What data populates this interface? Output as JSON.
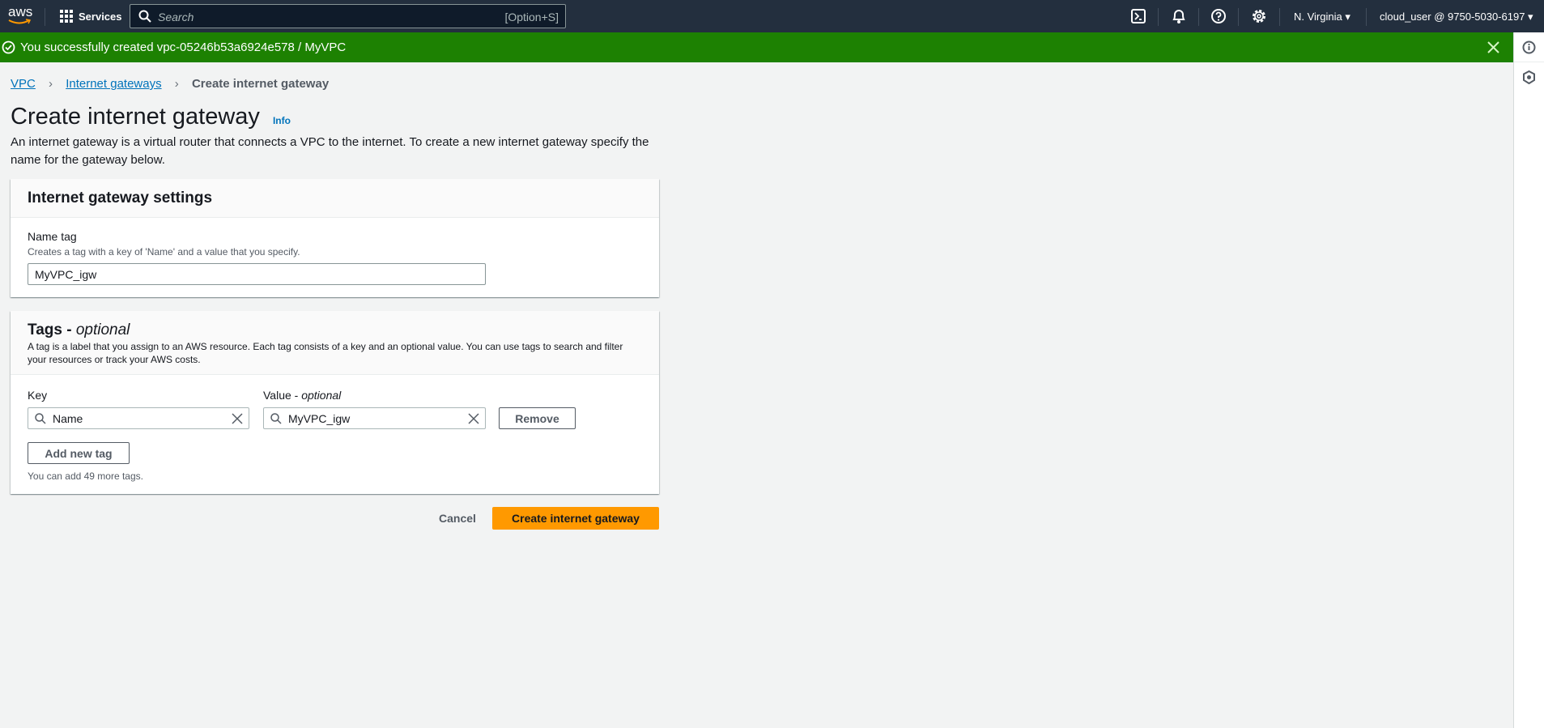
{
  "nav": {
    "logo_text": "aws",
    "services_label": "Services",
    "search_placeholder": "Search",
    "search_shortcut": "[Option+S]",
    "region": "N. Virginia",
    "account": "cloud_user @ 9750-5030-6197",
    "icons": [
      "grid-icon",
      "search-icon",
      "terminal-icon",
      "bell-icon",
      "help-icon",
      "gear-icon"
    ]
  },
  "banner": {
    "message": "You successfully created vpc-05246b53a6924e578 / MyVPC",
    "color": "#1d8102"
  },
  "breadcrumb": [
    "VPC",
    "Internet gateways",
    "Create internet gateway"
  ],
  "page": {
    "title": "Create internet gateway",
    "info": "Info",
    "description": "An internet gateway is a virtual router that connects a VPC to the internet. To create a new internet gateway specify the name for the gateway below."
  },
  "settings": {
    "title": "Internet gateway settings",
    "name_label": "Name tag",
    "name_desc": "Creates a tag with a key of 'Name' and a value that you specify.",
    "name_value": "MyVPC_igw"
  },
  "tags": {
    "title": "Tags - ",
    "title_optional": "optional",
    "description": "A tag is a label that you assign to an AWS resource. Each tag consists of a key and an optional value. You can use tags to search and filter your resources or track your AWS costs.",
    "key_label": "Key",
    "value_label": "Value - ",
    "value_optional": "optional",
    "rows": [
      {
        "key": "Name",
        "value": "MyVPC_igw"
      }
    ],
    "remove_label": "Remove",
    "add_label": "Add new tag",
    "limit_text": "You can add 49 more tags."
  },
  "actions": {
    "cancel": "Cancel",
    "create": "Create internet gateway",
    "primary_color": "#ff9900"
  }
}
